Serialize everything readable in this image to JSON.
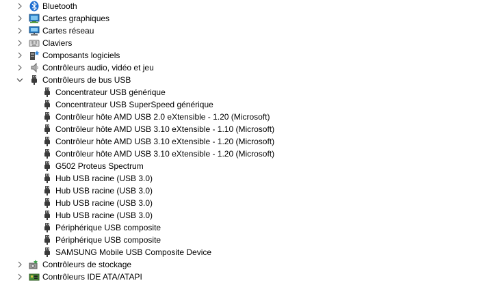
{
  "tree": {
    "categories_top": [
      {
        "label": "Bluetooth",
        "icon": "bluetooth-icon"
      },
      {
        "label": "Cartes graphiques",
        "icon": "display-adapter-icon"
      },
      {
        "label": "Cartes réseau",
        "icon": "network-adapter-icon"
      },
      {
        "label": "Claviers",
        "icon": "keyboard-icon"
      },
      {
        "label": "Composants logiciels",
        "icon": "software-component-icon"
      },
      {
        "label": "Contrôleurs audio, vidéo et jeu",
        "icon": "speaker-icon"
      }
    ],
    "usb_category": {
      "label": "Contrôleurs de bus USB",
      "icon": "usb-plug-icon",
      "expanded": true
    },
    "usb_devices": [
      {
        "label": "Concentrateur USB générique"
      },
      {
        "label": "Concentrateur USB SuperSpeed générique"
      },
      {
        "label": "Contrôleur hôte AMD USB 2.0 eXtensible - 1.20 (Microsoft)"
      },
      {
        "label": "Contrôleur hôte AMD USB 3.10 eXtensible - 1.10 (Microsoft)"
      },
      {
        "label": "Contrôleur hôte AMD USB 3.10 eXtensible - 1.20 (Microsoft)"
      },
      {
        "label": "Contrôleur hôte AMD USB 3.10 eXtensible - 1.20 (Microsoft)"
      },
      {
        "label": "G502 Proteus Spectrum"
      },
      {
        "label": "Hub USB racine (USB 3.0)"
      },
      {
        "label": "Hub USB racine (USB 3.0)"
      },
      {
        "label": "Hub USB racine (USB 3.0)"
      },
      {
        "label": "Hub USB racine (USB 3.0)"
      },
      {
        "label": "Périphérique USB composite"
      },
      {
        "label": "Périphérique USB composite"
      },
      {
        "label": "SAMSUNG Mobile USB Composite Device"
      }
    ],
    "categories_bottom": [
      {
        "label": "Contrôleurs de stockage",
        "icon": "storage-controller-icon"
      },
      {
        "label": "Contrôleurs IDE ATA/ATAPI",
        "icon": "ide-controller-icon"
      }
    ]
  },
  "colors": {
    "bluetooth": "#1f6fd1",
    "chevron": "#6b6b6b",
    "usb_plug": "#3a3a3a"
  }
}
